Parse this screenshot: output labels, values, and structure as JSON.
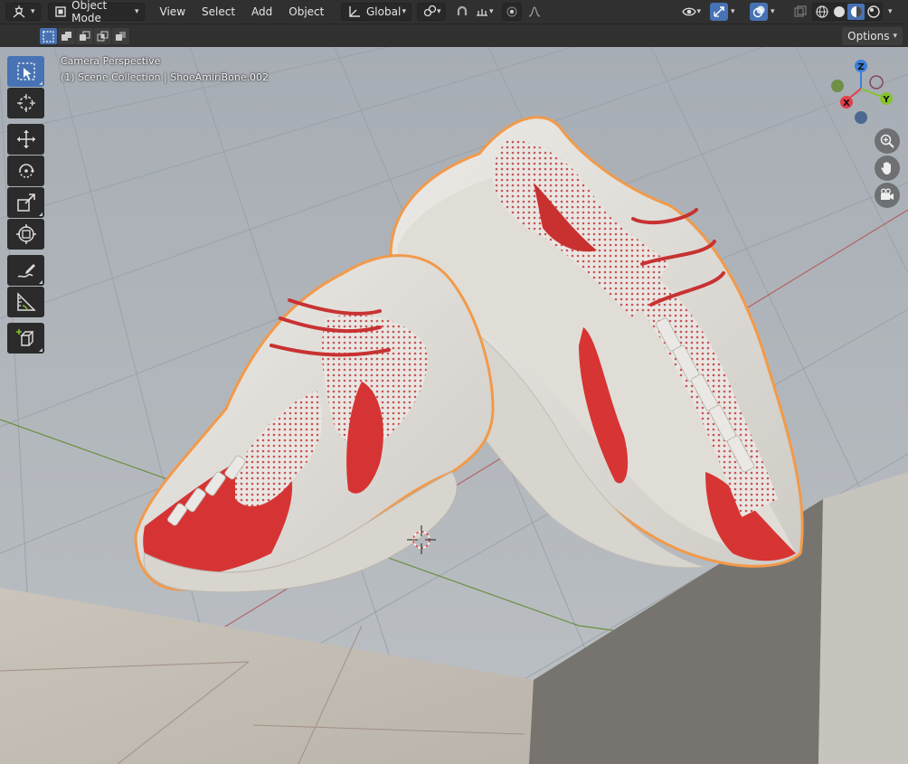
{
  "header": {
    "editor_type_icon": "3d-viewport-icon",
    "mode": {
      "label": "Object Mode",
      "icon": "object-mode-icon"
    },
    "menus": [
      "View",
      "Select",
      "Add",
      "Object"
    ],
    "transform_orientation": {
      "label": "Global",
      "icon": "transform-orientation-icon"
    },
    "pivot_icon": "pivot-point-icon",
    "snap_icon": "snap-icon",
    "snap_target_icon": "snap-increment-icon",
    "proportional_icon": "proportional-edit-icon",
    "falloff_icon": "falloff-curve-icon",
    "right_icons": [
      "visibility-eye-icon",
      "gizmo-icon",
      "overlay-icon",
      "xray-icon",
      "wireframe-shading-icon",
      "solid-shading-icon",
      "material-preview-icon",
      "rendered-shading-icon"
    ]
  },
  "tool_settings": {
    "select_modes": [
      "set",
      "extend",
      "subtract",
      "intersect",
      "invert"
    ],
    "options_label": "Options"
  },
  "viewport": {
    "view_name": "Camera Perspective",
    "collection_info": "(1) Scene Collection | ShoeAmiriBone.002"
  },
  "tools": [
    "select-box-icon",
    "cursor-icon",
    "move-icon",
    "rotate-icon",
    "scale-icon",
    "transform-icon",
    "annotate-icon",
    "measure-icon",
    "add-cube-icon"
  ],
  "gizmo": {
    "x": "X",
    "y": "Y",
    "z": "Z"
  },
  "colors": {
    "accent": "#4772b3",
    "axis_x": "#e33d4c",
    "axis_y": "#86c32f",
    "axis_z": "#3d7fd9",
    "selection_outline": "#f29a4a",
    "shoe_red": "#d63434",
    "shoe_white": "#e4e3df"
  }
}
